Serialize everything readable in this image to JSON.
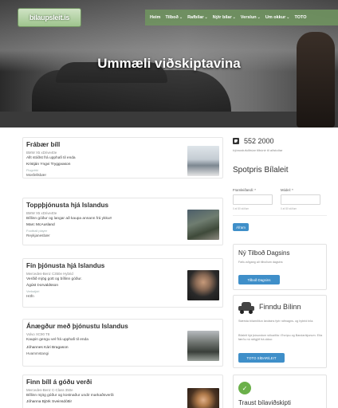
{
  "header": {
    "logo_text": "bilaupsleit.is",
    "nav": [
      {
        "label": "Heim",
        "has_dropdown": false
      },
      {
        "label": "Tilboð",
        "has_dropdown": true
      },
      {
        "label": "Rafbílar",
        "has_dropdown": true
      },
      {
        "label": "Nýir bílar",
        "has_dropdown": true
      },
      {
        "label": "Verslun",
        "has_dropdown": true
      },
      {
        "label": "Um okkur",
        "has_dropdown": true
      },
      {
        "label": "TOTO",
        "has_dropdown": false
      }
    ]
  },
  "hero": {
    "title": "Ummæli viðskiptavina"
  },
  "testimonials": [
    {
      "title": "Frábær bíll",
      "car": "BMW X5 xDrive40e",
      "quote": "Allt stóðst frá upphafi til enda",
      "name": "Kristján Yngvi Tryggvason",
      "role": "Flugvirki",
      "city": "Mosfellsbær"
    },
    {
      "title": "Toppþjónusta hjá Islandus",
      "car": "BMW X5 xDrive40e",
      "quote": "Bíllinn góður og langar að kaupa annann frá ykkur!",
      "name": "Marc McAusland",
      "role": "Football player",
      "city": "Reykjanesbær"
    },
    {
      "title": "Fín þjónusta hjá Islandus",
      "car": "Mercedes-Benz C350e Hybrid",
      "quote": "Verðið mjög gott og bíllinn góður.",
      "name": "Ágúst Þorvaldsson",
      "role": "Verkstjóri",
      "city": "Höfn"
    },
    {
      "title": "Ánægður með þjónustu Islandus",
      "car": "Volvo XC90 T8",
      "quote": "Kaupin gengu vel frá upphafi til enda",
      "name": "Jóhannes Kári Bragason",
      "role": "",
      "city": "Hvammstangi"
    },
    {
      "title": "Finn bíll á góðu verði",
      "car": "Mercedes-Benz C-Class 350e",
      "quote": "Bíllinn mjög góður og kostnaður undir markaðsverði",
      "name": "Jóhanna Björk Sveinsdóttir",
      "role": "",
      "city": ""
    }
  ],
  "sidebar": {
    "phone": "552 2000",
    "phone_note": "Þjónustufulltrúar tilbúnir til aðstoðar",
    "spot_title": "Spotpris Bílaleit",
    "form": {
      "make_label": "Framleiðandi: *",
      "model_label": "Módel: *",
      "make_hint": "0 af 80 stöfum",
      "model_hint": "0 af 80 stöfum",
      "submit_label": "Áfram"
    },
    "box1": {
      "title": "Ný Tilboð Dagsins",
      "text": "Fáðu aðgang að tilboðum dagsins",
      "button": "Tilboð Dagsins"
    },
    "box2": {
      "title": "Finndu Bílinn",
      "text1": "Stærsta bílamiðlun landsins fyrir rafmagns- og hybrid bíla.",
      "text2": "Bílaleit hjá þúsundum söluaðila í Evrópu og Bandaríkjunum. Eða færðu nú ráðgjöf frá okkur.",
      "button": "TOTO SÍÐAR/LEIT"
    },
    "box3": {
      "title": "Traust bílaviðskipti"
    }
  }
}
